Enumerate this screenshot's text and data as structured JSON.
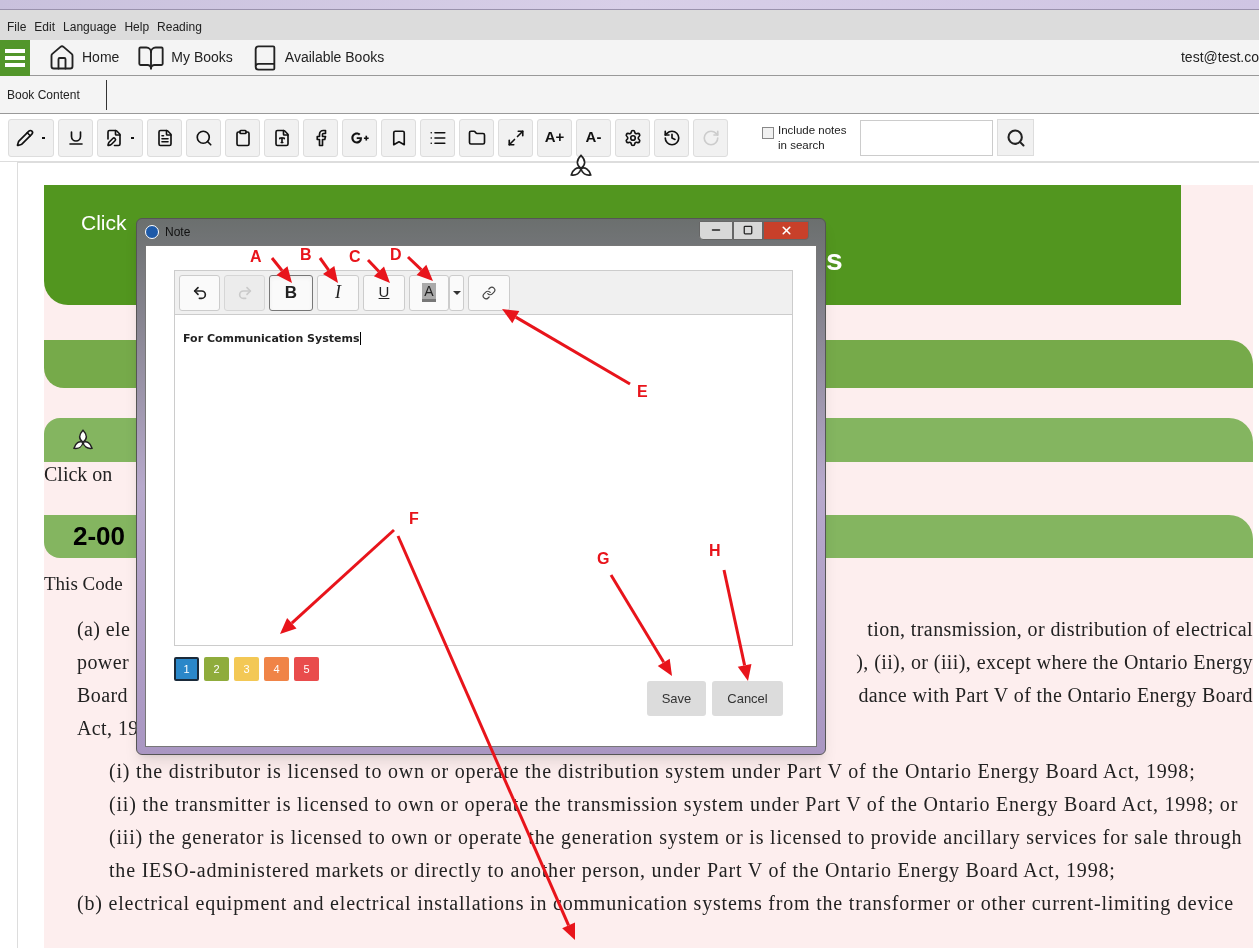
{
  "menu": [
    "File",
    "Edit",
    "Language",
    "Help",
    "Reading"
  ],
  "nav": {
    "items": [
      "Home",
      "My Books",
      "Available Books"
    ],
    "user": "test@test.co"
  },
  "tabs": [
    {
      "label": "Book Content",
      "selected": true
    }
  ],
  "toolbar": {
    "buttons": [
      {
        "kind": "icon",
        "dropdown": true,
        "disabled": false
      },
      {
        "kind": "icon",
        "dropdown": false,
        "disabled": false
      },
      {
        "kind": "icon",
        "dropdown": true,
        "disabled": false
      },
      {
        "kind": "icon",
        "dropdown": false,
        "disabled": false
      },
      {
        "kind": "icon",
        "dropdown": false,
        "disabled": false
      },
      {
        "kind": "icon",
        "dropdown": false,
        "disabled": false
      },
      {
        "kind": "icon",
        "dropdown": false,
        "disabled": false
      },
      {
        "kind": "icon",
        "dropdown": false,
        "disabled": false
      },
      {
        "kind": "icon",
        "dropdown": false,
        "disabled": false
      },
      {
        "kind": "icon",
        "dropdown": false,
        "disabled": false
      },
      {
        "kind": "icon",
        "dropdown": false,
        "disabled": false
      },
      {
        "kind": "icon",
        "dropdown": false,
        "disabled": false
      },
      {
        "kind": "icon",
        "dropdown": false,
        "disabled": false
      },
      {
        "kind": "text",
        "label": "A+",
        "disabled": false
      },
      {
        "kind": "text",
        "label": "A-",
        "disabled": false
      },
      {
        "kind": "icon",
        "dropdown": false,
        "disabled": false
      },
      {
        "kind": "icon",
        "dropdown": false,
        "disabled": false
      },
      {
        "kind": "icon",
        "dropdown": false,
        "disabled": true
      }
    ],
    "include_notes": {
      "label": "Include notes in search",
      "checked": false
    }
  },
  "book": {
    "header_text": "Click",
    "header_title_fragment": "s",
    "click_line": "Click on",
    "section_number": "2-00",
    "intro": "This Code",
    "split_lines": [
      {
        "left": "(a) ele",
        "right": "tion, transmission, or distribution of electrical"
      },
      {
        "left": "power",
        "right": "), (ii), or (iii), except where the Ontario Energy"
      },
      {
        "left": "Board",
        "right": "dance with Part V of the Ontario Energy Board"
      },
      {
        "left": "Act, 19"
      }
    ],
    "items": [
      {
        "kind": "sub",
        "text": "(i) the distributor is licensed to own or operate the distribution system under Part V of the Ontario Energy Board Act, 1998;"
      },
      {
        "kind": "sub",
        "text": "(ii) the transmitter is licensed to own or operate the transmission system under Part V of the Ontario Energy Board Act, 1998; or"
      },
      {
        "kind": "sub",
        "text": "(iii) the generator is licensed to own or operate the generation system or is licensed to provide ancillary services for sale through"
      },
      {
        "kind": "sub",
        "text": "the IESO-administered markets or directly to another person, under Part V of the Ontario Energy Board Act, 1998;"
      },
      {
        "kind": "main",
        "text": "(b) electrical equipment and electrical installations in communication systems from the transformer or other current-limiting device"
      }
    ]
  },
  "dialog": {
    "title": "Note",
    "tools": [
      {
        "kind": "undo",
        "disabled": false
      },
      {
        "kind": "redo",
        "disabled": true
      },
      {
        "kind": "bold",
        "label": "B",
        "selected": true
      },
      {
        "kind": "italic",
        "label": "I",
        "selected": false
      },
      {
        "kind": "underline",
        "label": "U",
        "selected": false
      },
      {
        "kind": "highlight",
        "label": "A",
        "selected": false
      },
      {
        "kind": "dropdown"
      },
      {
        "kind": "link",
        "disabled": false
      }
    ],
    "text": "For Communication Systems",
    "colors": [
      {
        "label": "1",
        "color": "#2a87c9",
        "selected": true
      },
      {
        "label": "2",
        "color": "#8fac3c",
        "selected": false
      },
      {
        "label": "3",
        "color": "#f3c855",
        "selected": false
      },
      {
        "label": "4",
        "color": "#f08447",
        "selected": false
      },
      {
        "label": "5",
        "color": "#e94c4c",
        "selected": false
      }
    ],
    "buttons": [
      "Save",
      "Cancel"
    ]
  },
  "annotations": [
    {
      "label": "A"
    },
    {
      "label": "B"
    },
    {
      "label": "C"
    },
    {
      "label": "D"
    },
    {
      "label": "E"
    },
    {
      "label": "F"
    },
    {
      "label": "G"
    },
    {
      "label": "H"
    }
  ]
}
